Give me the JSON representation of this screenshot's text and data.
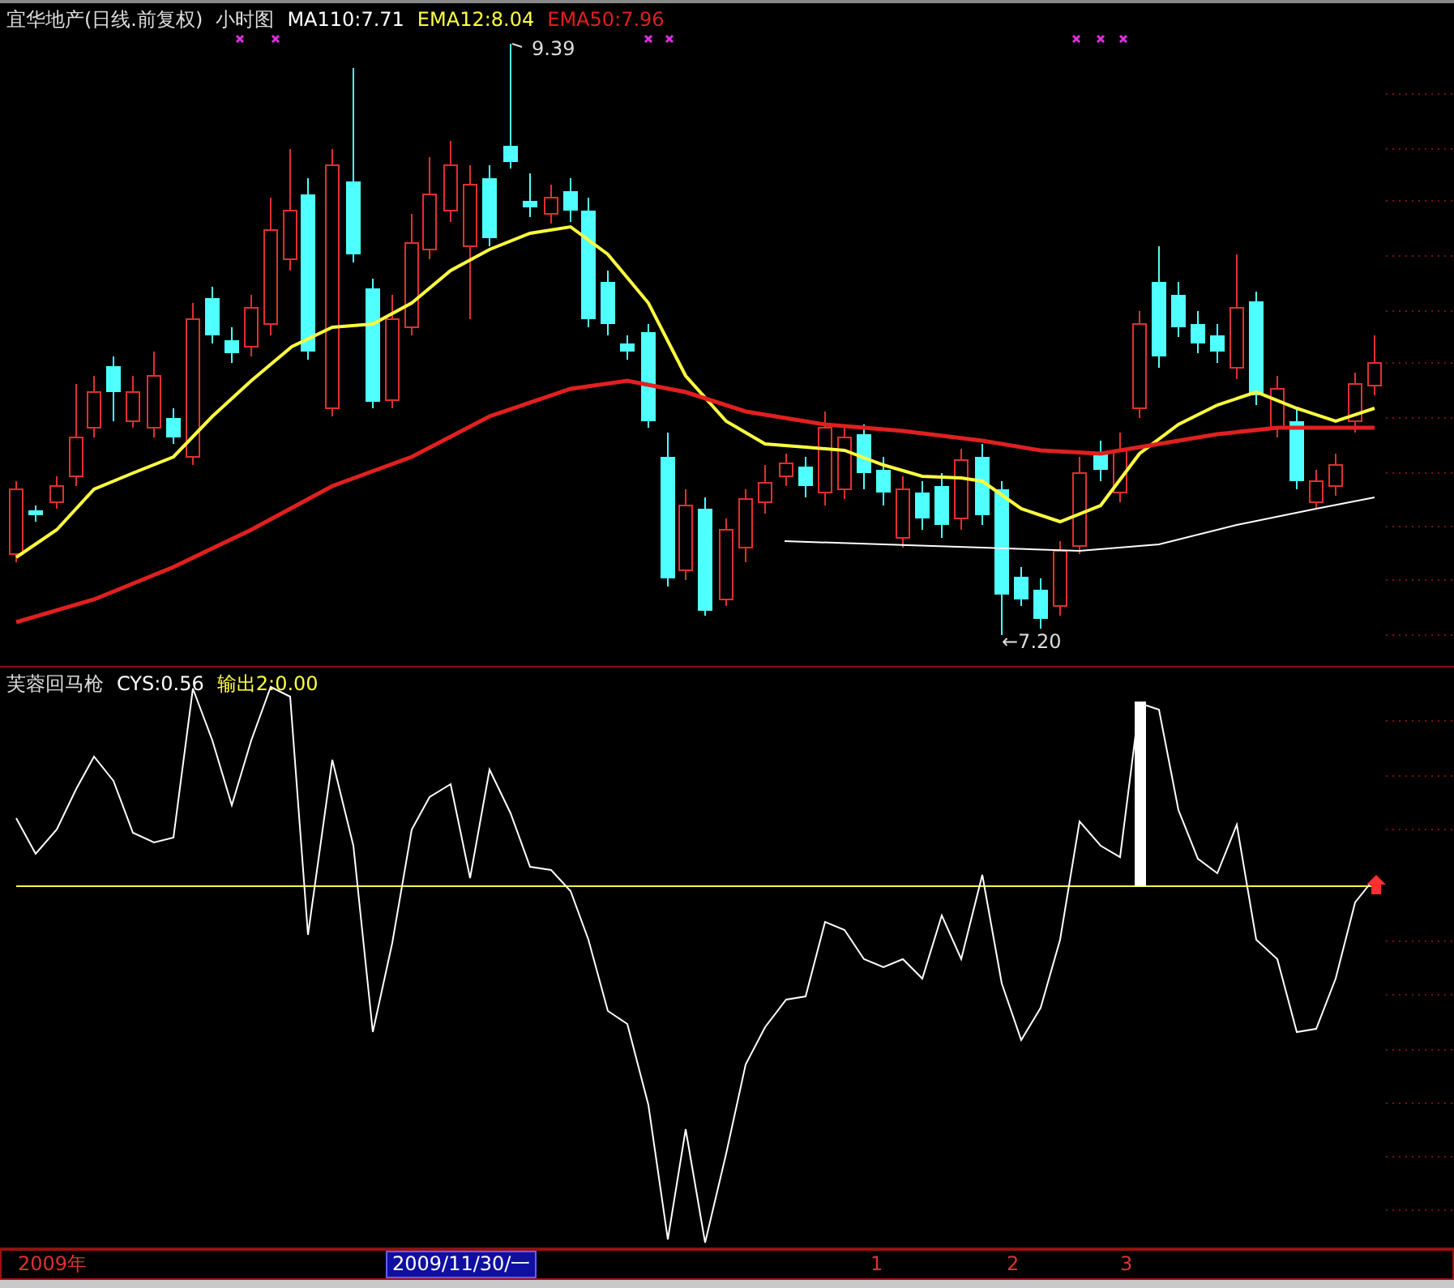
{
  "price_panel": {
    "stock_name": "宜华地产(日线.前复权)",
    "period": "小时图",
    "indicators": [
      {
        "label": "MA110:7.71",
        "color": "#ffffff"
      },
      {
        "label": "EMA12:8.04",
        "color": "#ffff40"
      },
      {
        "label": "EMA50:7.96",
        "color": "#e02020"
      }
    ],
    "high_marker": "9.39",
    "low_marker": "←7.20"
  },
  "indicator_panel": {
    "name": "芙蓉回马枪",
    "values": [
      {
        "label": "CYS:0.56",
        "color": "#ffffff"
      },
      {
        "label": "输出2:0.00",
        "color": "#ffff40"
      }
    ]
  },
  "time_axis": {
    "year": "2009年",
    "cursor_date": "2009/11/30/一",
    "ticks": [
      "1",
      "2",
      "3"
    ]
  }
}
